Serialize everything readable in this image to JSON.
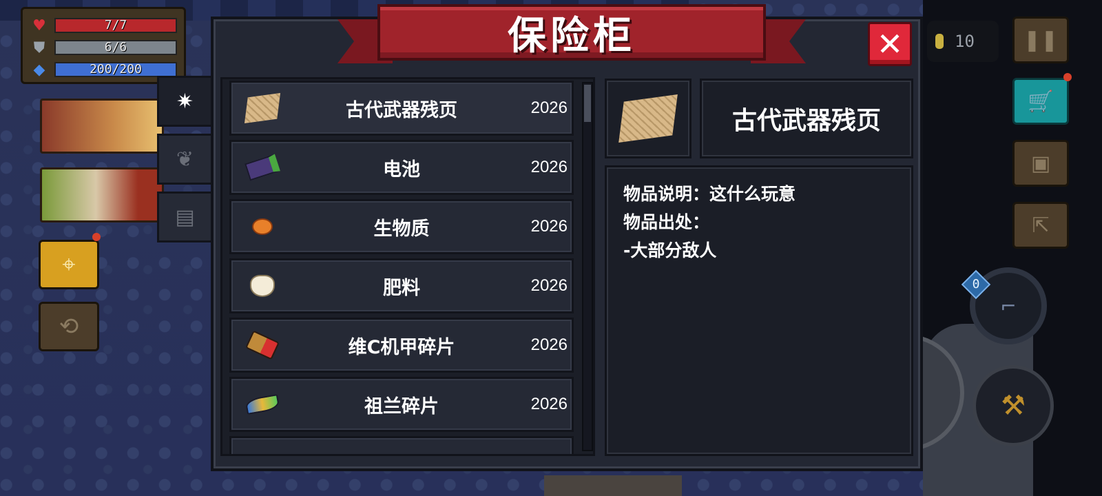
{
  "hud": {
    "health": "7/7",
    "health_fraction": 1.0,
    "armor": "6/6",
    "armor_fraction": 1.0,
    "energy": "200/200",
    "energy_fraction": 1.0,
    "coins": "10",
    "weapon_level": "0"
  },
  "vault": {
    "title": "保险柜",
    "close_label": "✕",
    "tabs": [
      {
        "icon": "material-icon",
        "glyph": "✷",
        "selected": true
      },
      {
        "icon": "plant-icon",
        "glyph": "❦",
        "selected": false
      },
      {
        "icon": "ticket-icon",
        "glyph": "▤",
        "selected": false
      }
    ],
    "items": [
      {
        "name": "古代武器残页",
        "count": "2026",
        "icon": "parchment-icon",
        "selected": true
      },
      {
        "name": "电池",
        "count": "2026",
        "icon": "battery-icon",
        "selected": false
      },
      {
        "name": "生物质",
        "count": "2026",
        "icon": "biomass-icon",
        "selected": false
      },
      {
        "name": "肥料",
        "count": "2026",
        "icon": "fertilizer-icon",
        "selected": false
      },
      {
        "name": "维C机甲碎片",
        "count": "2026",
        "icon": "mech-fragment-icon",
        "selected": false
      },
      {
        "name": "祖兰碎片",
        "count": "2026",
        "icon": "zulan-fragment-icon",
        "selected": false
      }
    ],
    "detail": {
      "name": "古代武器残页",
      "icon": "parchment-icon",
      "lines": [
        "物品说明：这什么玩意",
        "物品出处：",
        "-大部分敌人"
      ]
    }
  },
  "colors": {
    "banner": "#a0232b",
    "close": "#e0283a",
    "health": "#b8282c",
    "armor": "#7d858c",
    "energy": "#3f6fd2",
    "panel": "#232733"
  }
}
